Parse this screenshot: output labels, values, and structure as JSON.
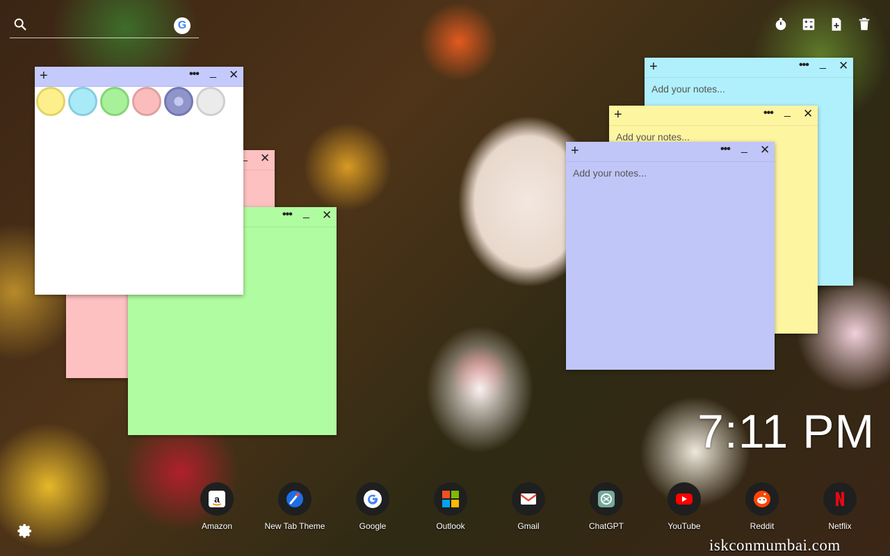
{
  "search": {
    "placeholder": ""
  },
  "google_icon": {
    "glyph": "G",
    "name": "google-icon"
  },
  "toolbar": {
    "icons": [
      "timer-icon",
      "calculator-icon",
      "add-note-icon",
      "delete-icon"
    ]
  },
  "notes": {
    "placeholder": "Add your notes...",
    "add_glyph": "+",
    "more_glyph": "•••",
    "min_glyph": "_",
    "close_glyph": "✕",
    "colors": {
      "yellow": "#fdf5a0",
      "cyan": "#b0f0fc",
      "green": "#b0fca0",
      "pink": "#fdc1c1",
      "blue": "#c0c6f8",
      "white": "#ffffff",
      "header_blue": "#c4cafc"
    },
    "swatches": [
      "#fdf08c",
      "#a9eaf9",
      "#a8f19a",
      "#fbbcbc",
      "#8f95c9",
      "#ebebeb"
    ]
  },
  "clock": {
    "time": "7:11 PM"
  },
  "shortcuts": [
    {
      "label": "Amazon",
      "icon": "amazon-icon"
    },
    {
      "label": "New Tab Theme",
      "icon": "new-tab-theme-icon"
    },
    {
      "label": "Google",
      "icon": "google-icon"
    },
    {
      "label": "Outlook",
      "icon": "outlook-icon"
    },
    {
      "label": "Gmail",
      "icon": "gmail-icon"
    },
    {
      "label": "ChatGPT",
      "icon": "chatgpt-icon"
    },
    {
      "label": "YouTube",
      "icon": "youtube-icon"
    },
    {
      "label": "Reddit",
      "icon": "reddit-icon"
    },
    {
      "label": "Netflix",
      "icon": "netflix-icon"
    }
  ],
  "watermark": "iskconmumbai.com"
}
